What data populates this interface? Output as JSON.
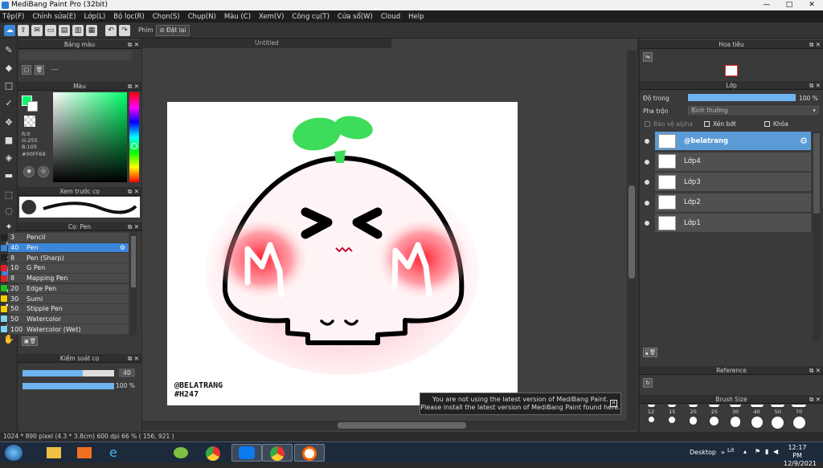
{
  "window": {
    "title": "MediBang Paint Pro (32bit)",
    "min": "—",
    "max": "□",
    "close": "✕"
  },
  "menu": [
    "Tệp(F)",
    "Chỉnh sửa(E)",
    "Lớp(L)",
    "Bộ lọc(R)",
    "Chọn(S)",
    "Chụp(N)",
    "Màu (C)",
    "Xem(V)",
    "Công cụ(T)",
    "Cửa sổ(W)",
    "Cloud",
    "Help"
  ],
  "toolbar": {
    "phim_label": "Phím",
    "reset_label": "Đặt lại"
  },
  "panels": {
    "color_bar": "Bảng màu",
    "color_bar_more": "---",
    "color": "Màu",
    "rgb": {
      "r": "R:0",
      "g": "G:255",
      "b": "B:105",
      "hex": "#00FF69"
    },
    "brush_preview": "Xem trước cọ",
    "brush": "Cọ: Pen",
    "brush_control": "Kiểm soát cọ",
    "brush_size": "40",
    "brush_opacity": "100 %"
  },
  "brushes": [
    {
      "size": "3",
      "name": "Pencil",
      "color": "#222222"
    },
    {
      "size": "40",
      "name": "Pen",
      "color": "#3b86d8",
      "selected": true
    },
    {
      "size": "8",
      "name": "Pen (Sharp)",
      "color": "#222222"
    },
    {
      "size": "10",
      "name": "G Pen",
      "color": "#e02020"
    },
    {
      "size": "8",
      "name": "Mapping Pen",
      "color": "#e02020"
    },
    {
      "size": "20",
      "name": "Edge Pen",
      "color": "#20c020"
    },
    {
      "size": "30",
      "name": "Sumi",
      "color": "#f0d000"
    },
    {
      "size": "50",
      "name": "Stipple Pen",
      "color": "#f0d000"
    },
    {
      "size": "50",
      "name": "Watercolor",
      "color": "#80d0f0"
    },
    {
      "size": "100",
      "name": "Watercolor (Wet)",
      "color": "#80d0f0"
    }
  ],
  "canvas": {
    "tab": "Untitled",
    "signature_line1": "@BELATRANG",
    "signature_line2": "#H247"
  },
  "navigator": {
    "title": "Hoa tiêu"
  },
  "layers": {
    "title": "Lớp",
    "opacity_label": "Độ trong",
    "opacity_value": "100 %",
    "blend_label": "Pha trộn",
    "blend_value": "Bình thường",
    "protect_alpha": "Bảo vệ alpha",
    "clipping": "Xén bớt",
    "lock": "Khóa",
    "items": [
      {
        "name": "@belatrang",
        "selected": true
      },
      {
        "name": "Lớp4"
      },
      {
        "name": "Lớp3"
      },
      {
        "name": "Lớp2"
      },
      {
        "name": "Lớp1"
      }
    ]
  },
  "reference": {
    "title": "Reference"
  },
  "brush_size_panel": {
    "title": "Brush Size",
    "sizes": [
      "12",
      "15",
      "20",
      "25",
      "30",
      "40",
      "50",
      "70"
    ]
  },
  "notification": {
    "line1": "You are not using the latest version of MediBang Paint.",
    "line2": "Please install the latest version of MediBang Paint found here."
  },
  "status": {
    "text": "1024 * 890 pixel  (4.3 * 3.8cm)  600 dpi  66 %  ( 156, 921 )"
  },
  "taskbar": {
    "desktop": "Desktop",
    "lang": "Lit",
    "time": "12:17 PM",
    "date": "12/9/2021"
  },
  "colors": {
    "accent": "#3b86d8",
    "selected_color": "#00FF69"
  }
}
